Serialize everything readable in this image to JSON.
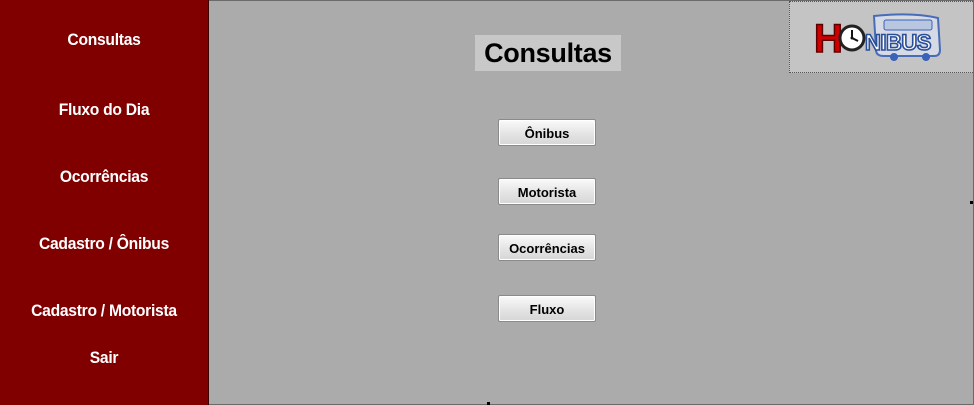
{
  "sidebar": {
    "items": [
      {
        "label": "Consultas"
      },
      {
        "label": "Fluxo do Dia"
      },
      {
        "label": "Ocorrências"
      },
      {
        "label": "Cadastro / Ônibus"
      },
      {
        "label": "Cadastro / Motorista"
      },
      {
        "label": "Sair"
      }
    ]
  },
  "main": {
    "title": "Consultas",
    "buttons": [
      {
        "label": "Ônibus"
      },
      {
        "label": "Motorista"
      },
      {
        "label": "Ocorrências"
      },
      {
        "label": "Fluxo"
      }
    ]
  },
  "logo": {
    "text": "HONIBUS",
    "icons": [
      "bus-icon",
      "clock-icon"
    ]
  },
  "colors": {
    "sidebar": "#800000",
    "main_background": "#ababab",
    "title_background": "#c8c8c8",
    "logo_background": "#c4c4c4",
    "logo_red": "#cc0000",
    "logo_blue": "#3a63b8"
  }
}
